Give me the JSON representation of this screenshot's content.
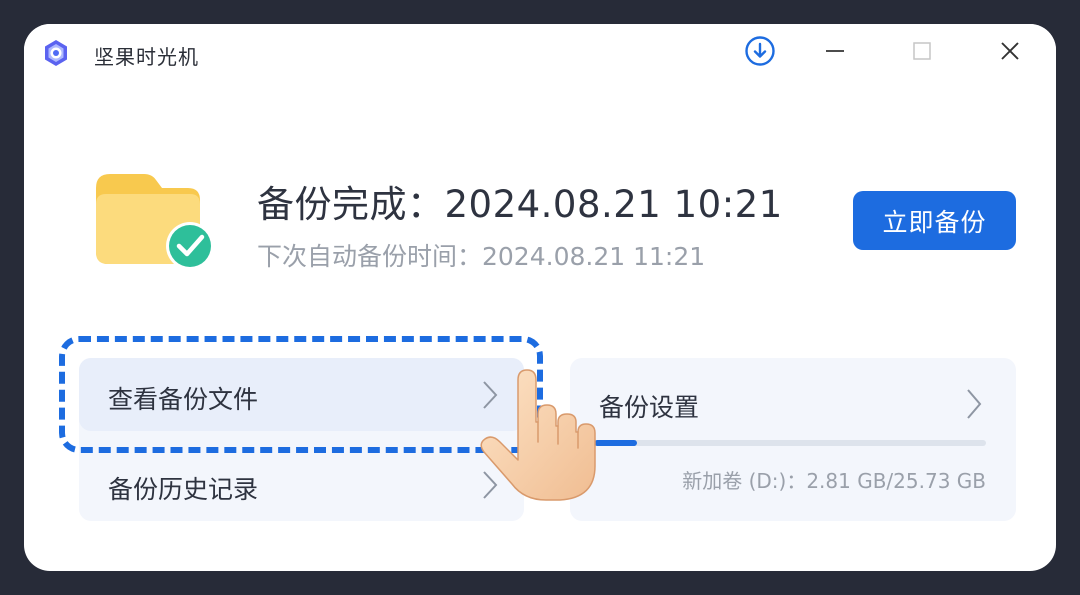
{
  "app": {
    "title": "坚果时光机"
  },
  "status": {
    "title": "备份完成：2024.08.21 10:21",
    "next_backup": "下次自动备份时间：2024.08.21 11:21"
  },
  "actions": {
    "backup_now_label": "立即备份"
  },
  "menu": [
    {
      "label": "查看备份文件"
    },
    {
      "label": "备份历史记录"
    }
  ],
  "settings": {
    "label": "备份设置",
    "disk_info": "新加卷 (D:)：2.81 GB/25.73 GB",
    "disk_usage_fraction": 0.109
  },
  "colors": {
    "accent": "#1d6ce0",
    "success": "#2ebf9a",
    "folder": "#f9cf5d"
  },
  "icons": [
    "app-logo-icon",
    "download-icon",
    "minimize-icon",
    "maximize-icon",
    "close-icon",
    "folder-icon",
    "check-icon",
    "chevron-right-icon",
    "hand-pointer-icon"
  ]
}
